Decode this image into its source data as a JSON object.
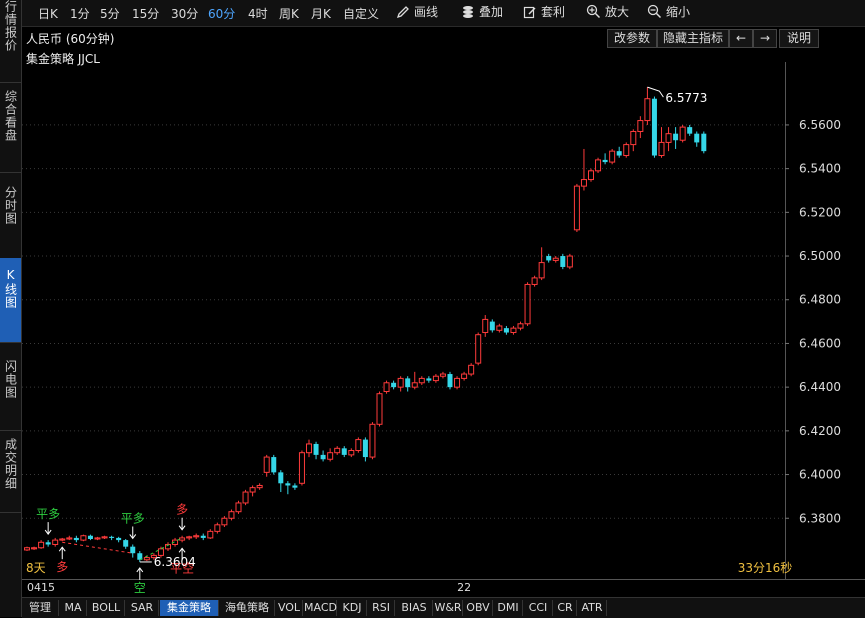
{
  "sidebar": {
    "tabs": [
      {
        "label": "行情报价",
        "active": false
      },
      {
        "label": "综合看盘",
        "active": false
      },
      {
        "label": "分时图",
        "active": false
      },
      {
        "label": "K线图",
        "active": true
      },
      {
        "label": "闪电图",
        "active": false
      },
      {
        "label": "成交明细",
        "active": false
      }
    ]
  },
  "toolbar": {
    "periods": [
      {
        "label": "日K",
        "active": false
      },
      {
        "label": "1分",
        "active": false
      },
      {
        "label": "5分",
        "active": false
      },
      {
        "label": "15分",
        "active": false
      },
      {
        "label": "30分",
        "active": false
      },
      {
        "label": "60分",
        "active": true
      },
      {
        "label": "4时",
        "active": false
      },
      {
        "label": "周K",
        "active": false
      },
      {
        "label": "月K",
        "active": false
      },
      {
        "label": "自定义",
        "active": false
      }
    ],
    "tools": [
      {
        "label": "画线",
        "icon": "pencil-icon"
      },
      {
        "label": "叠加",
        "icon": "stack-icon"
      },
      {
        "label": "套利",
        "icon": "edit-icon"
      },
      {
        "label": "放大",
        "icon": "zoom-in-icon"
      },
      {
        "label": "缩小",
        "icon": "zoom-out-icon"
      }
    ]
  },
  "infobar": {
    "title": "人民币 (60分钟)",
    "modify_params": "改参数",
    "hide_indicator": "隐藏主指标",
    "prev_arrow": "←",
    "next_arrow": "→",
    "help": "说明"
  },
  "strategy_label": "集金策略 JJCL",
  "chart_data": {
    "type": "candlestick",
    "y_ticks": [
      6.38,
      6.4,
      6.42,
      6.44,
      6.46,
      6.48,
      6.5,
      6.52,
      6.54,
      6.56
    ],
    "y_tick_labels": [
      "6.3800",
      "6.4000",
      "6.4200",
      "6.4400",
      "6.4600",
      "6.4800",
      "6.5000",
      "6.5200",
      "6.5400",
      "6.5600"
    ],
    "ylim": [
      6.3522,
      6.5888
    ],
    "x_labels": [
      {
        "text": "0415",
        "index": 0
      },
      {
        "text": "22",
        "index": 62
      }
    ],
    "max_label": "6.5773",
    "min_label": "6.3604",
    "countdown": "33分16秒",
    "days_label": "8天",
    "colors": {
      "up": "#ff3b3b",
      "down": "#35d7e8",
      "grid": "#3a3a3a",
      "axis": "#dddddd",
      "buy": "#ff3b3b",
      "sell": "#2ecc40"
    },
    "signals": [
      {
        "text": "平多",
        "index": 3,
        "position": "above",
        "color": "#2ecc40"
      },
      {
        "text": "多",
        "index": 5,
        "position": "below",
        "color": "#ff3b3b"
      },
      {
        "text": "平多",
        "index": 15,
        "position": "above",
        "color": "#2ecc40"
      },
      {
        "text": "空",
        "index": 16,
        "position": "below",
        "color": "#2ecc40"
      },
      {
        "text": "多",
        "index": 22,
        "position": "above",
        "color": "#ff3b3b"
      },
      {
        "text": "平空",
        "index": 22,
        "position": "below",
        "color": "#ff3b3b"
      }
    ],
    "candles": [
      [
        6.3655,
        6.3665,
        6.365,
        6.367
      ],
      [
        6.366,
        6.3665,
        6.3655,
        6.367
      ],
      [
        6.3665,
        6.369,
        6.366,
        6.37
      ],
      [
        6.369,
        6.368,
        6.367,
        6.37
      ],
      [
        6.368,
        6.37,
        6.367,
        6.371
      ],
      [
        6.37,
        6.3705,
        6.3695,
        6.371
      ],
      [
        6.3705,
        6.371,
        6.37,
        6.372
      ],
      [
        6.371,
        6.37,
        6.369,
        6.372
      ],
      [
        6.37,
        6.372,
        6.3695,
        6.3725
      ],
      [
        6.372,
        6.3705,
        6.37,
        6.3725
      ],
      [
        6.3705,
        6.371,
        6.37,
        6.3715
      ],
      [
        6.371,
        6.3715,
        6.3705,
        6.372
      ],
      [
        6.3715,
        6.371,
        6.37,
        6.372
      ],
      [
        6.371,
        6.37,
        6.369,
        6.3715
      ],
      [
        6.37,
        6.367,
        6.366,
        6.3705
      ],
      [
        6.367,
        6.364,
        6.362,
        6.368
      ],
      [
        6.364,
        6.361,
        6.36,
        6.365
      ],
      [
        6.361,
        6.362,
        6.3604,
        6.363
      ],
      [
        6.362,
        6.363,
        6.361,
        6.364
      ],
      [
        6.363,
        6.366,
        6.362,
        6.367
      ],
      [
        6.366,
        6.368,
        6.365,
        6.369
      ],
      [
        6.368,
        6.37,
        6.367,
        6.371
      ],
      [
        6.37,
        6.371,
        6.369,
        6.372
      ],
      [
        6.371,
        6.3715,
        6.37,
        6.372
      ],
      [
        6.3715,
        6.372,
        6.3705,
        6.373
      ],
      [
        6.372,
        6.371,
        6.37,
        6.373
      ],
      [
        6.371,
        6.374,
        6.3705,
        6.375
      ],
      [
        6.374,
        6.377,
        6.373,
        6.378
      ],
      [
        6.377,
        6.38,
        6.376,
        6.381
      ],
      [
        6.38,
        6.383,
        6.379,
        6.384
      ],
      [
        6.383,
        6.387,
        6.382,
        6.388
      ],
      [
        6.387,
        6.392,
        6.386,
        6.393
      ],
      [
        6.392,
        6.394,
        6.39,
        6.395
      ],
      [
        6.394,
        6.395,
        6.393,
        6.396
      ],
      [
        6.401,
        6.408,
        6.399,
        6.409
      ],
      [
        6.408,
        6.401,
        6.4,
        6.409
      ],
      [
        6.401,
        6.396,
        6.392,
        6.402
      ],
      [
        6.396,
        6.395,
        6.391,
        6.397
      ],
      [
        6.395,
        6.394,
        6.393,
        6.396
      ],
      [
        6.396,
        6.41,
        6.395,
        6.411
      ],
      [
        6.41,
        6.414,
        6.408,
        6.416
      ],
      [
        6.414,
        6.409,
        6.407,
        6.415
      ],
      [
        6.409,
        6.407,
        6.406,
        6.411
      ],
      [
        6.407,
        6.41,
        6.406,
        6.412
      ],
      [
        6.41,
        6.412,
        6.409,
        6.413
      ],
      [
        6.412,
        6.409,
        6.408,
        6.413
      ],
      [
        6.409,
        6.411,
        6.408,
        6.412
      ],
      [
        6.411,
        6.416,
        6.41,
        6.417
      ],
      [
        6.416,
        6.408,
        6.406,
        6.417
      ],
      [
        6.408,
        6.423,
        6.407,
        6.424
      ],
      [
        6.423,
        6.437,
        6.422,
        6.438
      ],
      [
        6.438,
        6.442,
        6.437,
        6.443
      ],
      [
        6.442,
        6.44,
        6.439,
        6.443
      ],
      [
        6.44,
        6.444,
        6.438,
        6.445
      ],
      [
        6.444,
        6.44,
        6.438,
        6.445
      ],
      [
        6.44,
        6.442,
        6.439,
        6.447
      ],
      [
        6.442,
        6.444,
        6.441,
        6.445
      ],
      [
        6.444,
        6.443,
        6.442,
        6.445
      ],
      [
        6.443,
        6.445,
        6.442,
        6.446
      ],
      [
        6.445,
        6.446,
        6.444,
        6.447
      ],
      [
        6.446,
        6.44,
        6.439,
        6.447
      ],
      [
        6.44,
        6.444,
        6.439,
        6.445
      ],
      [
        6.444,
        6.446,
        6.443,
        6.447
      ],
      [
        6.446,
        6.45,
        6.445,
        6.451
      ],
      [
        6.451,
        6.464,
        6.45,
        6.465
      ],
      [
        6.465,
        6.471,
        6.463,
        6.473
      ],
      [
        6.47,
        6.466,
        6.465,
        6.471
      ],
      [
        6.466,
        6.468,
        6.465,
        6.469
      ],
      [
        6.467,
        6.465,
        6.464,
        6.468
      ],
      [
        6.465,
        6.467,
        6.464,
        6.468
      ],
      [
        6.467,
        6.469,
        6.466,
        6.47
      ],
      [
        6.469,
        6.487,
        6.468,
        6.488
      ],
      [
        6.487,
        6.49,
        6.486,
        6.491
      ],
      [
        6.49,
        6.497,
        6.489,
        6.504
      ],
      [
        6.5,
        6.498,
        6.497,
        6.501
      ],
      [
        6.498,
        6.499,
        6.497,
        6.5
      ],
      [
        6.5,
        6.495,
        6.494,
        6.501
      ],
      [
        6.495,
        6.5,
        6.494,
        6.501
      ],
      [
        6.512,
        6.532,
        6.511,
        6.533
      ],
      [
        6.532,
        6.535,
        6.53,
        6.549
      ],
      [
        6.535,
        6.539,
        6.534,
        6.54
      ],
      [
        6.539,
        6.544,
        6.538,
        6.545
      ],
      [
        6.544,
        6.543,
        6.542,
        6.547
      ],
      [
        6.543,
        6.548,
        6.542,
        6.549
      ],
      [
        6.548,
        6.546,
        6.545,
        6.55
      ],
      [
        6.546,
        6.551,
        6.545,
        6.552
      ],
      [
        6.551,
        6.557,
        6.548,
        6.558
      ],
      [
        6.557,
        6.562,
        6.554,
        6.564
      ],
      [
        6.562,
        6.572,
        6.56,
        6.5773
      ],
      [
        6.572,
        6.546,
        6.545,
        6.573
      ],
      [
        6.546,
        6.552,
        6.545,
        6.559
      ],
      [
        6.552,
        6.556,
        6.548,
        6.559
      ],
      [
        6.556,
        6.553,
        6.549,
        6.559
      ],
      [
        6.553,
        6.559,
        6.552,
        6.56
      ],
      [
        6.559,
        6.556,
        6.555,
        6.56
      ],
      [
        6.556,
        6.552,
        6.55,
        6.557
      ],
      [
        6.556,
        6.548,
        6.547,
        6.557
      ]
    ]
  },
  "bottom_tabs": [
    {
      "label": "管理",
      "active": false
    },
    {
      "label": "MA",
      "active": false
    },
    {
      "label": "BOLL",
      "active": false
    },
    {
      "label": "SAR",
      "active": false
    },
    {
      "label": "集金策略",
      "active": true
    },
    {
      "label": "海龟策略",
      "active": false
    },
    {
      "label": "VOL",
      "active": false
    },
    {
      "label": "MACD",
      "active": false
    },
    {
      "label": "KDJ",
      "active": false
    },
    {
      "label": "RSI",
      "active": false
    },
    {
      "label": "BIAS",
      "active": false
    },
    {
      "label": "W&R",
      "active": false
    },
    {
      "label": "OBV",
      "active": false
    },
    {
      "label": "DMI",
      "active": false
    },
    {
      "label": "CCI",
      "active": false
    },
    {
      "label": "CR",
      "active": false
    },
    {
      "label": "ATR",
      "active": false
    }
  ]
}
